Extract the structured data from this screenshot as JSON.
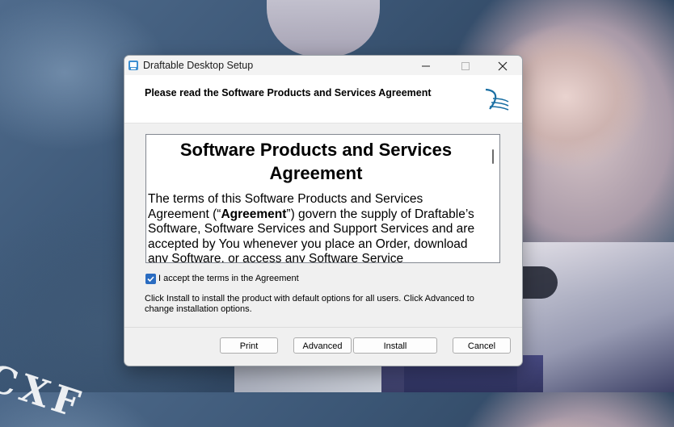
{
  "background": {
    "watermark": "CXF"
  },
  "window": {
    "title": "Draftable Desktop Setup",
    "header_title": "Please read the Software Products and Services Agreement",
    "icons": {
      "app": "setup-installer-icon",
      "logo": "draftable-logo-icon",
      "minimize": "minimize-icon",
      "maximize": "maximize-icon",
      "close": "close-icon"
    }
  },
  "license": {
    "title": "Software Products and Services Agreement",
    "body_prefix": "The terms of this Software Products and Services Agreement (“",
    "body_bold": "Agreement",
    "body_suffix": "”) govern the supply of Draftable’s Software, Software Services and Support Services and are accepted by You whenever you place an Order, download any Software, or access any Software Service"
  },
  "accept": {
    "label": "I accept the terms in the Agreement",
    "checked": true
  },
  "info_text": "Click Install to install the product with default options for all users. Click Advanced to change installation options.",
  "buttons": {
    "print": "Print",
    "advanced": "Advanced",
    "install": "Install",
    "cancel": "Cancel"
  },
  "colors": {
    "accent": "#2a6cc1",
    "logo": "#1a6fa3"
  }
}
